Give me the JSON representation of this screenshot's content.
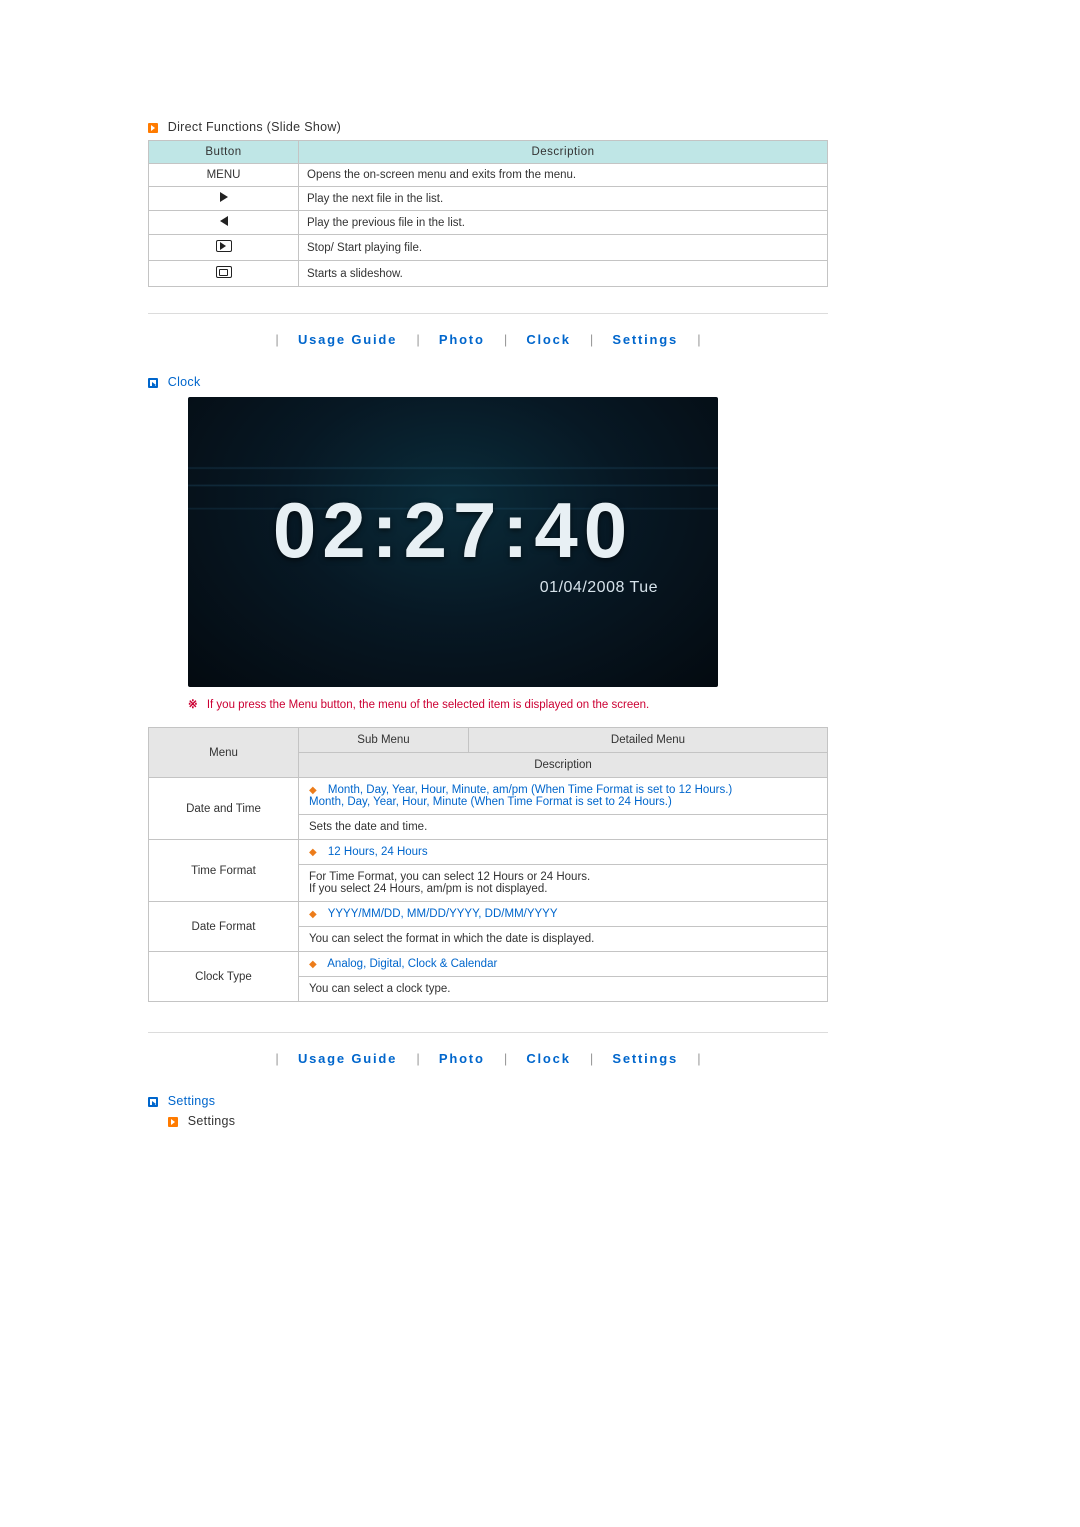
{
  "direct_functions": {
    "title": "Direct Functions (Slide Show)",
    "cols": {
      "button": "Button",
      "desc": "Description"
    },
    "rows": [
      {
        "btn": "MENU",
        "btn_kind": "text",
        "desc": "Opens the on-screen menu and exits from the menu."
      },
      {
        "btn": "▶",
        "btn_kind": "arrow-right",
        "desc": "Play the next file in the list."
      },
      {
        "btn": "◀",
        "btn_kind": "arrow-left",
        "desc": "Play the previous file in the list."
      },
      {
        "btn": "play-toggle",
        "btn_kind": "icon-play",
        "desc": "Stop/ Start playing file."
      },
      {
        "btn": "slideshow",
        "btn_kind": "icon-slide",
        "desc": "Starts a slideshow."
      }
    ]
  },
  "nav": {
    "items": [
      "Usage Guide",
      "Photo",
      "Clock",
      "Settings"
    ]
  },
  "clock": {
    "heading": "Clock",
    "time": "02:27:40",
    "date": "01/04/2008 Tue",
    "note_mark": "※",
    "note": "If you press the Menu button, the menu of the selected item is displayed on the screen.",
    "cols": {
      "menu": "Menu",
      "sub": "Sub Menu",
      "detail": "Detailed Menu",
      "desc": "Description"
    },
    "rows": [
      {
        "menu": "Date and Time",
        "sub": "Month, Day, Year, Hour, Minute, am/pm (When Time Format is set to 12 Hours.)\nMonth, Day, Year, Hour, Minute (When Time Format is set to 24 Hours.)",
        "desc": "Sets the date and time."
      },
      {
        "menu": "Time Format",
        "sub": "12 Hours, 24 Hours",
        "desc": "For Time Format, you can select 12 Hours or 24 Hours.\nIf you select 24 Hours, am/pm is not displayed."
      },
      {
        "menu": "Date Format",
        "sub": "YYYY/MM/DD, MM/DD/YYYY, DD/MM/YYYY",
        "desc": "You can select the format in which the date is displayed."
      },
      {
        "menu": "Clock Type",
        "sub": "Analog, Digital, Clock & Calendar",
        "desc": "You can select a clock type."
      }
    ]
  },
  "settings": {
    "heading": "Settings",
    "sub_heading": "Settings"
  }
}
